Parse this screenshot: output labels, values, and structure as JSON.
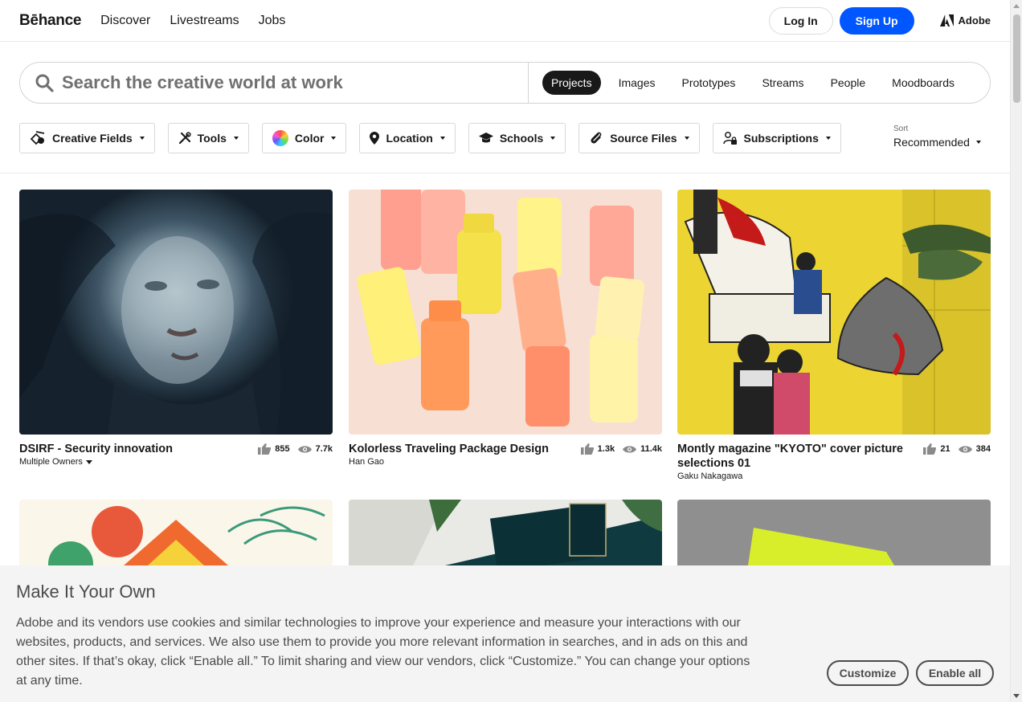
{
  "nav": {
    "logo": "Bēhance",
    "links": [
      "Discover",
      "Livestreams",
      "Jobs"
    ],
    "login": "Log In",
    "signup": "Sign Up",
    "adobe": "Adobe"
  },
  "search": {
    "placeholder": "Search the creative world at work",
    "tabs": [
      "Projects",
      "Images",
      "Prototypes",
      "Streams",
      "People",
      "Moodboards"
    ],
    "active_tab": "Projects"
  },
  "filters": {
    "items": [
      "Creative Fields",
      "Tools",
      "Color",
      "Location",
      "Schools",
      "Source Files",
      "Subscriptions"
    ],
    "icons": [
      "creative-fields-icon",
      "tools-icon",
      "color-wheel-icon",
      "location-pin-icon",
      "graduation-cap-icon",
      "paperclip-icon",
      "subscriptions-icon"
    ],
    "sort_label": "Sort",
    "sort_value": "Recommended"
  },
  "projects": [
    {
      "title": "DSIRF - Security innovation",
      "owner": "Multiple Owners",
      "likes": "855",
      "views": "7.7k"
    },
    {
      "title": "Kolorless Traveling Package Design",
      "owner": "Han Gao",
      "likes": "1.3k",
      "views": "11.4k"
    },
    {
      "title": "Montly magazine \"KYOTO\" cover picture selections 01",
      "owner": "Gaku Nakagawa",
      "likes": "21",
      "views": "384"
    }
  ],
  "cookie": {
    "title": "Make It Your Own",
    "text": "Adobe and its vendors use cookies and similar technologies to improve your experience and measure your interactions with our websites, products, and services. We also use them to provide you more relevant information in searches, and in ads on this and other sites. If that’s okay, click “Enable all.” To limit sharing and view our vendors, click “Customize.” You can change your options at any time.",
    "customize": "Customize",
    "enable_all": "Enable all"
  },
  "colors": {
    "brand_blue": "#0057ff",
    "active_tab": "#191919"
  }
}
